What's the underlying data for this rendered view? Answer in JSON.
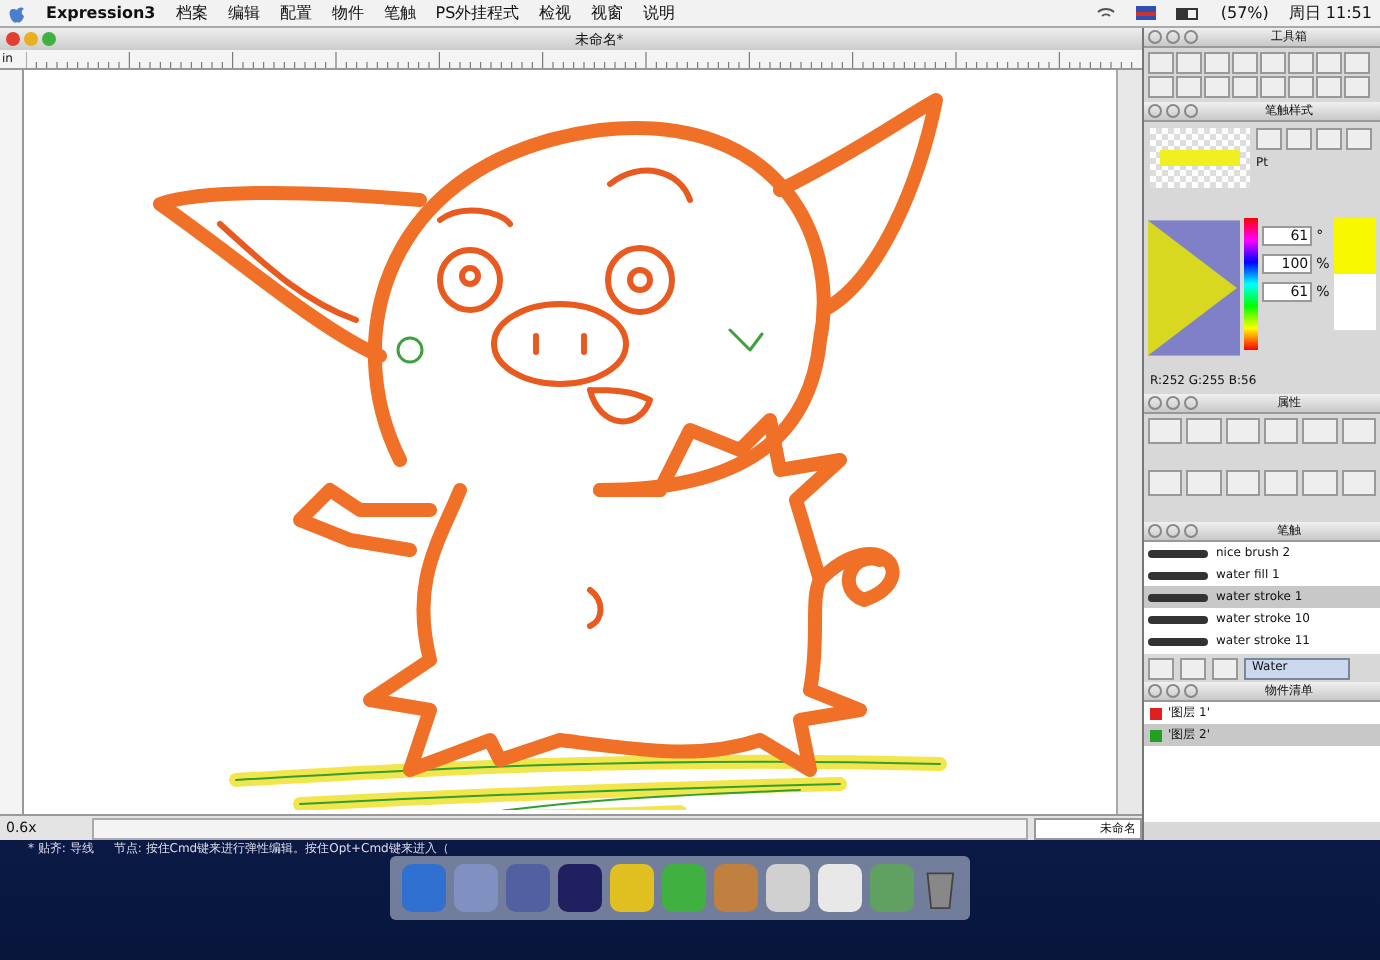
{
  "menubar": {
    "app": "Expression3",
    "menus": [
      "档案",
      "编辑",
      "配置",
      "物件",
      "笔触",
      "PS外挂程式",
      "检视",
      "视窗",
      "说明"
    ],
    "battery": "(57%)",
    "clock": "周日 11:51"
  },
  "document": {
    "title": "未命名*",
    "ruler_unit": "in",
    "zoom": "0.6x",
    "page_field": "未命名"
  },
  "toolbox": {
    "title": "工具箱"
  },
  "stroke_style": {
    "title": "笔触样式",
    "size_unit": "Pt"
  },
  "color": {
    "hue": "61",
    "hue_unit": "°",
    "saturation": "100",
    "saturation_unit": "%",
    "brightness": "61",
    "brightness_unit": "%",
    "rgb": "R:252  G:255  B:56"
  },
  "properties": {
    "title": "属性"
  },
  "brushes": {
    "title": "笔触",
    "library": "Water",
    "items": [
      {
        "label": "nice brush 2",
        "selected": false
      },
      {
        "label": "water fill 1",
        "selected": false
      },
      {
        "label": "water stroke 1",
        "selected": true
      },
      {
        "label": "water stroke 10",
        "selected": false
      },
      {
        "label": "water stroke 11",
        "selected": false
      }
    ]
  },
  "layers": {
    "title": "物件清单",
    "items": [
      {
        "label": "'图层 1'",
        "color": "#e02020",
        "selected": false
      },
      {
        "label": "'图层 2'",
        "color": "#20a020",
        "selected": true
      }
    ]
  },
  "status_hint": [
    "* 贴齐: 导线",
    "节点: 按住Cmd键来进行弹性编辑。按住Opt+Cmd键来进入（"
  ]
}
